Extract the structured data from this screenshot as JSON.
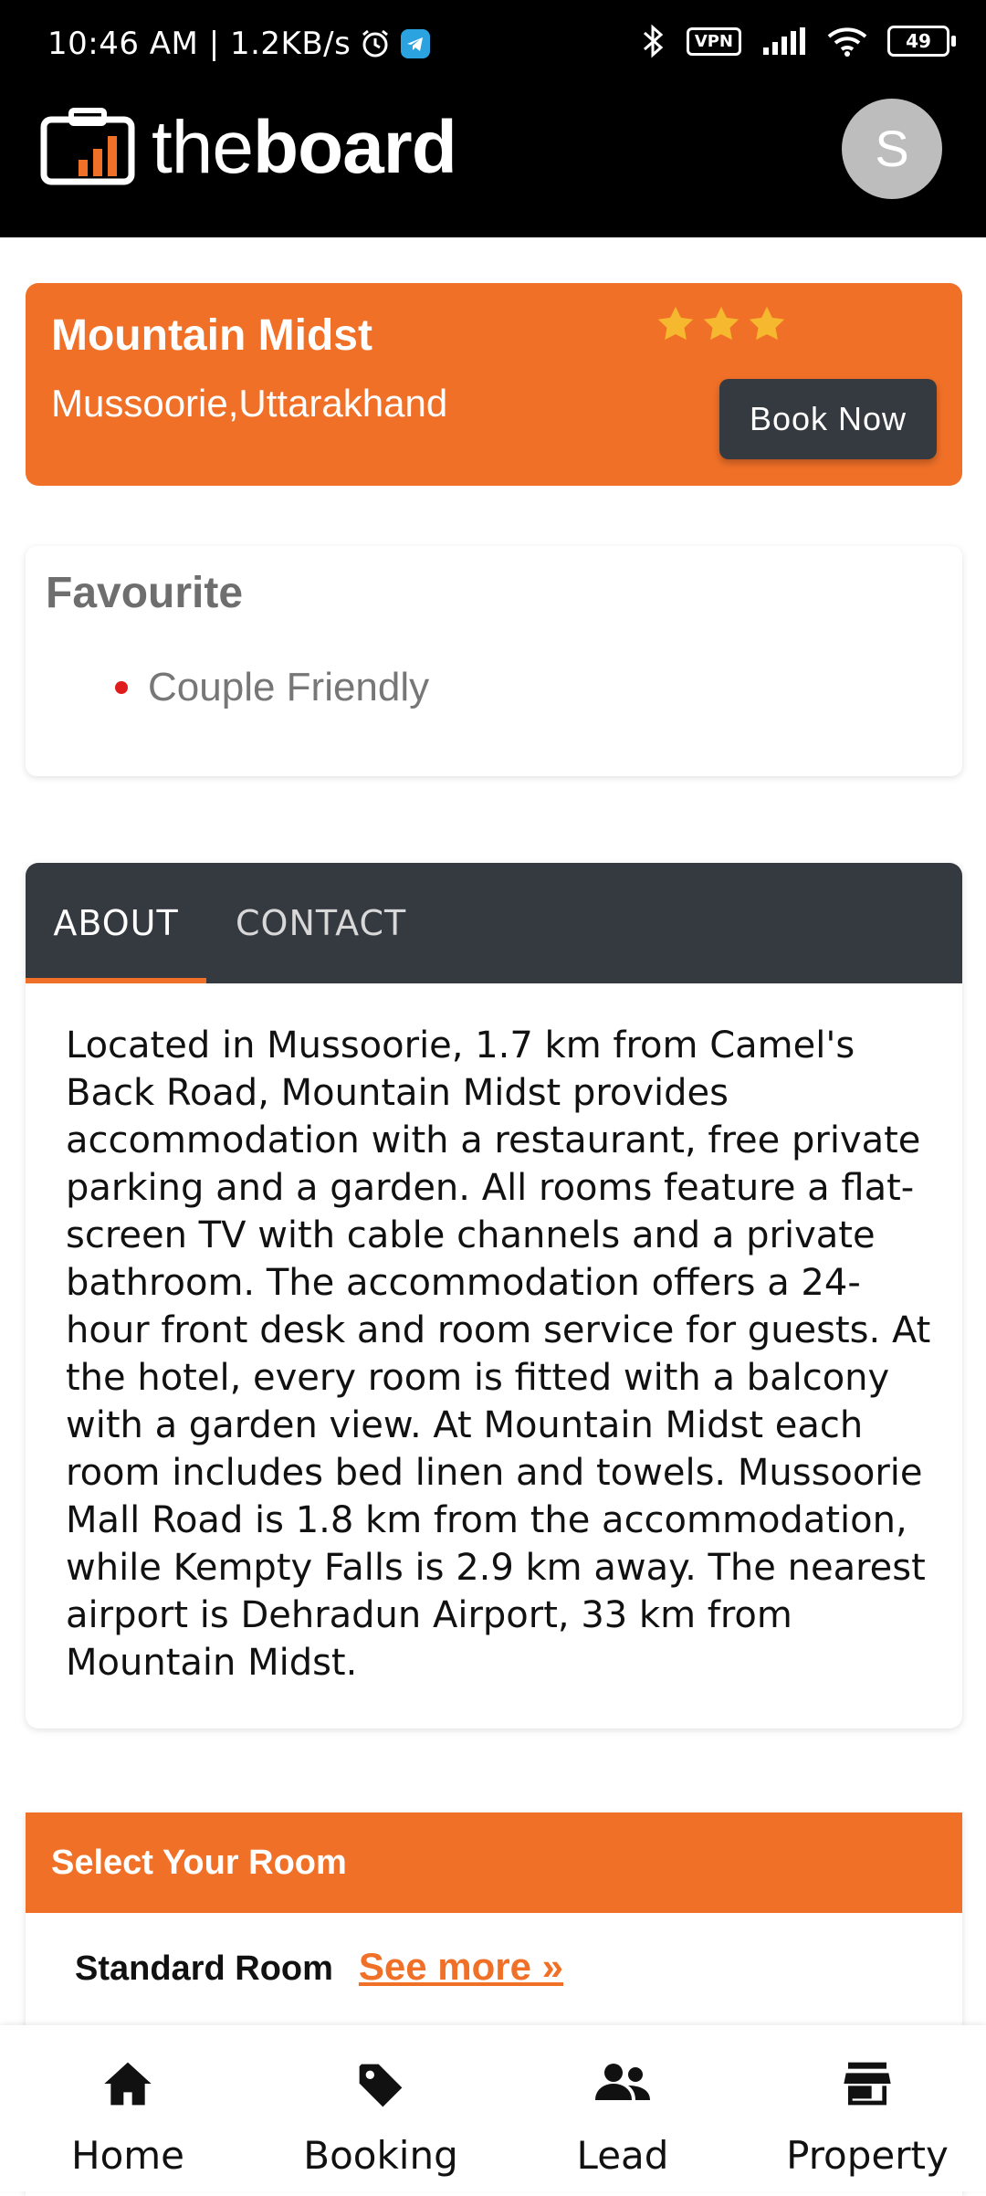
{
  "status_bar": {
    "time_speed": "10:46 AM | 1.2KB/s",
    "vpn": "VPN",
    "battery": "49"
  },
  "header": {
    "logo_thin": "the",
    "logo_bold": "board",
    "avatar_initial": "S"
  },
  "hotel": {
    "name": "Mountain Midst",
    "location": "Mussoorie,Uttarakhand",
    "stars": 3,
    "book_label": "Book Now"
  },
  "favourite": {
    "title": "Favourite",
    "items": [
      "Couple Friendly"
    ]
  },
  "tabs": [
    {
      "label": "ABOUT",
      "active": true
    },
    {
      "label": "CONTACT",
      "active": false
    }
  ],
  "about_text": "Located in Mussoorie, 1.7 km from Camel's Back Road, Mountain Midst provides accommodation with a restaurant, free private parking and a garden. All rooms feature a flat-screen TV with cable channels and a private bathroom. The accommodation offers a 24-hour front desk and room service for guests. At the hotel, every room is fitted with a balcony with a garden view. At Mountain Midst each room includes bed linen and towels. Mussoorie Mall Road is 1.8 km from the accommodation, while Kempty Falls is 2.9 km away. The nearest airport is Dehradun Airport, 33 km from Mountain Midst.",
  "rooms": {
    "title": "Select Your Room",
    "items": [
      {
        "name": "Standard Room",
        "link": "See more »"
      }
    ]
  },
  "bottom_nav": [
    {
      "label": "Home",
      "icon": "home-icon"
    },
    {
      "label": "Booking",
      "icon": "tag-icon"
    },
    {
      "label": "Lead",
      "icon": "people-icon"
    },
    {
      "label": "Property",
      "icon": "store-icon"
    }
  ],
  "colors": {
    "accent": "#f07028",
    "dark": "#353a40",
    "header_bg": "#000000",
    "star": "#f5b82e"
  }
}
